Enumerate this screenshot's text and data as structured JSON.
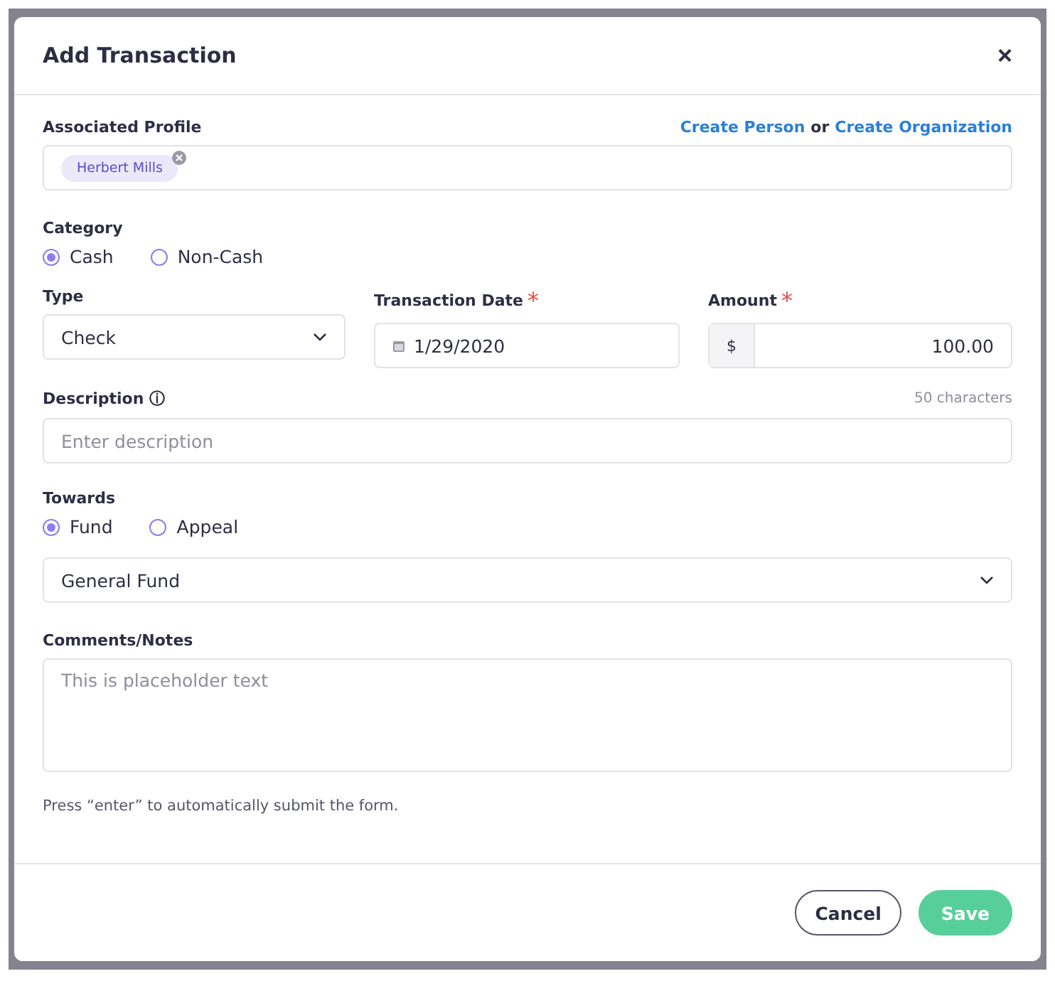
{
  "dialog": {
    "title": "Add Transaction",
    "close": "×"
  },
  "profile": {
    "label": "Associated Profile",
    "link_person": "Create Person",
    "link_or": "or",
    "link_org": "Create Organization",
    "tags": [
      {
        "label": "Herbert Mills"
      }
    ]
  },
  "category": {
    "label": "Category",
    "options": [
      {
        "label": "Cash",
        "selected": true
      },
      {
        "label": "Non-Cash",
        "selected": false
      }
    ]
  },
  "type": {
    "label": "Type",
    "value": "Check"
  },
  "date": {
    "label": "Transaction Date",
    "value": "1/29/2020",
    "required_mark": "*"
  },
  "amount": {
    "label": "Amount",
    "prefix": "$",
    "value": "100.00",
    "required_mark": "*"
  },
  "description": {
    "label": "Description",
    "info": "ⓘ",
    "counter": "50 characters",
    "placeholder": "Enter description"
  },
  "towards": {
    "label": "Towards",
    "options": [
      {
        "label": "Fund",
        "selected": true
      },
      {
        "label": "Appeal",
        "selected": false
      }
    ],
    "value": "General Fund"
  },
  "comments": {
    "label": "Comments/Notes",
    "placeholder": "This is placeholder text"
  },
  "hint": "Press “enter” to automatically submit the form.",
  "buttons": [
    {
      "label": "Cancel",
      "kind": "secondary"
    },
    {
      "label": "Save",
      "kind": "primary"
    }
  ]
}
